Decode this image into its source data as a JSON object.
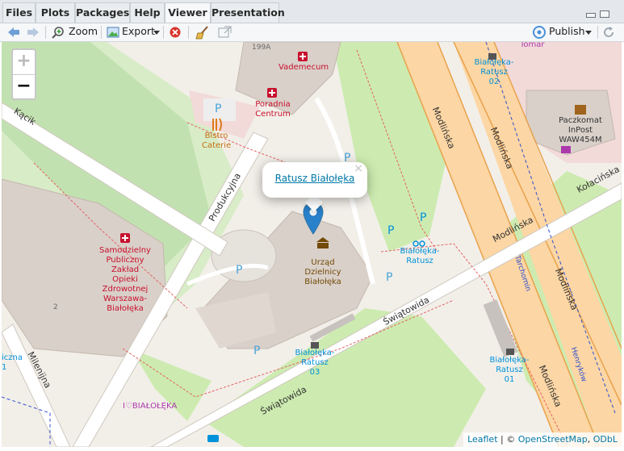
{
  "tabs": [
    "Files",
    "Plots",
    "Packages",
    "Help",
    "Viewer",
    "Presentation"
  ],
  "active_tab": "Viewer",
  "toolbar": {
    "zoom_label": "Zoom",
    "export_label": "Export",
    "publish_label": "Publish"
  },
  "map": {
    "zoom_in": "+",
    "zoom_out": "−",
    "popup_text": "Ratusz Białołęka",
    "popup_close": "×",
    "attribution_leaflet": "Leaflet",
    "attribution_sep": " | © ",
    "attribution_osm": "OpenStreetMap",
    "attribution_comma": ", ",
    "attribution_odbl": "ODbL",
    "labels": {
      "vademecum": "Vademecum",
      "poradnia_1": "Poradnia",
      "poradnia_2": "Centrum",
      "bistro_1": "Bistro",
      "bistro_2": "Caterie",
      "house_199a": "199A",
      "kacik": "Kącik",
      "produkcyjna": "Produkcyjna",
      "zaklad_1": "Samodzielny",
      "zaklad_2": "Publiczny",
      "zaklad_3": "Zakład",
      "zaklad_4": "Opieki",
      "zaklad_5": "Zdrowotnej",
      "zaklad_6": "Warszawa-",
      "zaklad_7": "Białołęka",
      "house_2": "2",
      "urzad_1": "Urząd",
      "urzad_2": "Dzielnicy",
      "urzad_3": "Białołęka",
      "bike_1": "Białołęka-",
      "bike_2": "Ratusz",
      "bus02_1": "Białołęka-",
      "bus02_2": "Ratusz",
      "bus02_3": "02",
      "tomar": "Tomar",
      "paczkomat_1": "Paczkomat",
      "paczkomat_2": "InPost",
      "paczkomat_3": "WAW454M",
      "modlinska_1": "Modlińska",
      "modlinska_2": "Modlińska",
      "modlinska_3": "Modlińska",
      "modlinska_4": "Modlińska",
      "modlinska_5": "Modlińska",
      "kolacinska": "Kołacińska",
      "tarchomin": "Tarchomin",
      "henrykow": "Henryków",
      "swiatowida_1": "Świątowida",
      "swiatowida_2": "Świątowida",
      "bus03_1": "Białołęka-",
      "bus03_2": "Ratusz",
      "bus03_3": "03",
      "bus01_1": "Białołęka-",
      "bus01_2": "Ratusz",
      "bus01_3": "01",
      "milenijna": "Milenijna",
      "bialoleka_shop": "I♡BIAŁOŁĘKA",
      "edge_left_1": "iczna",
      "edge_left_2": "1"
    }
  }
}
